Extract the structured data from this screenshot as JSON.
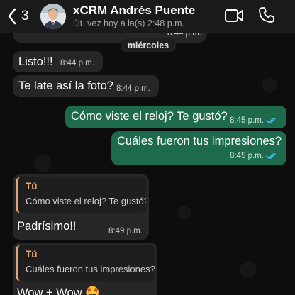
{
  "header": {
    "back_count": "3",
    "contact_name": "xCRM Andrés Puente",
    "last_seen": "últ. vez hoy a la(s) 2:48 p.m.",
    "icons": [
      "chevron-left-icon",
      "video-call-icon",
      "phone-icon"
    ]
  },
  "previous_image": {
    "time": "8:44 p.m."
  },
  "day_separator": "miércoles",
  "messages": [
    {
      "direction": "in",
      "text": "Listo!!!",
      "time": "8:44 p.m."
    },
    {
      "direction": "in",
      "text": "Te late así la foto?",
      "time": "8:44 p.m."
    },
    {
      "direction": "out",
      "text": "Cómo viste el reloj? Te gustó?",
      "time": "8:45 p.m.",
      "status": "read"
    },
    {
      "direction": "out",
      "text": "Cuáles fueron tus impresiones?",
      "time": "8:45 p.m.",
      "status": "read"
    },
    {
      "direction": "in",
      "reply_author": "Tú",
      "reply_text": "Cómo viste el reloj? Te gustó?",
      "text": "Padrísimo!!",
      "time": "8:49 p.m."
    },
    {
      "direction": "in",
      "reply_author": "Tú",
      "reply_text": "Cuáles fueron tus impresiones?",
      "text": "Wow + Wow 🤩",
      "time": ""
    }
  ],
  "colors": {
    "incoming_bubble": "#262626",
    "outgoing_bubble": "#1d6b4c",
    "reply_accent": "#e0a37a",
    "read_ticks": "#53bdeb"
  }
}
